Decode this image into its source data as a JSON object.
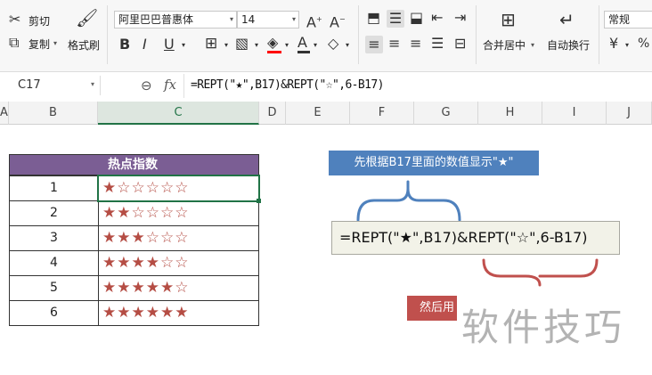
{
  "ribbon": {
    "cut_label": "剪切",
    "copy_label": "复制",
    "format_painter_label": "格式刷",
    "font_name": "阿里巴巴普惠体",
    "font_size": "14",
    "bold": "B",
    "italic": "I",
    "underline": "U",
    "merge_label": "合并居中",
    "wrap_label": "自动换行",
    "number_format": "常规",
    "currency_symbol": "¥",
    "percent_symbol": "%"
  },
  "formula_bar": {
    "cell_ref": "C17",
    "fx": "fx",
    "formula": "=REPT(\"★\",B17)&REPT(\"☆\",6-B17)"
  },
  "columns": [
    "A",
    "B",
    "C",
    "D",
    "E",
    "F",
    "G",
    "H",
    "I",
    "J"
  ],
  "table": {
    "header": "热点指数",
    "rows": [
      {
        "num": "1",
        "stars": "★☆☆☆☆☆"
      },
      {
        "num": "2",
        "stars": "★★☆☆☆☆"
      },
      {
        "num": "3",
        "stars": "★★★☆☆☆"
      },
      {
        "num": "4",
        "stars": "★★★★☆☆"
      },
      {
        "num": "5",
        "stars": "★★★★★☆"
      },
      {
        "num": "6",
        "stars": "★★★★★★"
      }
    ]
  },
  "annotations": {
    "blue_note": "先根据B17里面的数值显示\"★\"",
    "formula_box": "=REPT(\"★\",B17)&REPT(\"☆\",6-B17)",
    "red_note": "然后用",
    "watermark": "软件技巧"
  },
  "colors": {
    "header_purple": "#7b5e94",
    "star_red": "#b54d44",
    "note_blue": "#4f81bd",
    "note_red": "#c0504d",
    "selection_green": "#217346"
  }
}
